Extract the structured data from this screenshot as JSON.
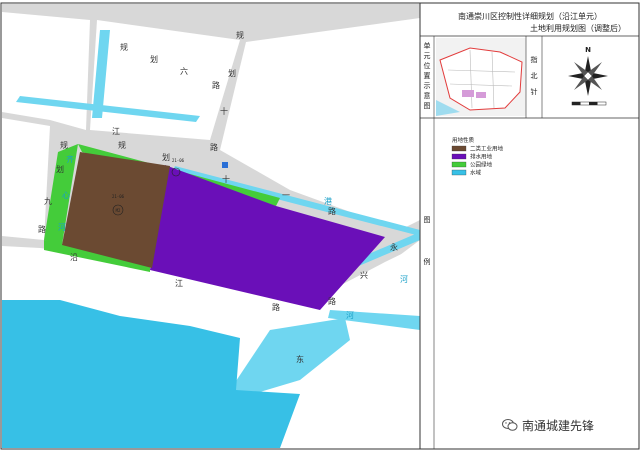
{
  "title": {
    "line1": "南通崇川区控制性详细规划（沿江单元）",
    "line2": "土地利用规划图（调整后）"
  },
  "side_panel": {
    "unit_location_label": [
      "单",
      "元",
      "位",
      "置",
      "示",
      "意",
      "图"
    ],
    "north_label": [
      "指",
      "北",
      "针"
    ],
    "north_letter": "N",
    "legend_label": [
      "图",
      "例"
    ]
  },
  "legend": {
    "title": "用地性质",
    "items": [
      {
        "label": "二类工业用地",
        "color": "#6b4a32"
      },
      {
        "label": "排水用地",
        "color": "#6a0fb8"
      },
      {
        "label": "公园绿地",
        "color": "#44cc3a"
      },
      {
        "label": "水域",
        "color": "#37c0e6"
      }
    ]
  },
  "map": {
    "roads": [
      {
        "id": "road-gui-hua-liu",
        "chars": [
          "规",
          "划",
          "六",
          "路"
        ]
      },
      {
        "id": "road-gui-hua-shi",
        "chars": [
          "规",
          "划",
          "十",
          "路"
        ]
      },
      {
        "id": "road-jiang-gui-hua",
        "chars": [
          "江",
          "规",
          "划"
        ]
      },
      {
        "id": "road-shi-yi-lu",
        "chars": [
          "十",
          "一",
          "路"
        ]
      },
      {
        "id": "road-yong-xing",
        "chars": [
          "永",
          "兴",
          "路"
        ]
      },
      {
        "id": "road-yan-jiang",
        "chars": [
          "沿",
          "江",
          "路"
        ]
      },
      {
        "id": "road-gui-hua-jiu",
        "chars": [
          "规",
          "划",
          "九",
          "路"
        ]
      },
      {
        "id": "road-dong",
        "chars": [
          "东"
        ]
      }
    ],
    "waterways": [
      {
        "id": "water-qi-xin-he",
        "chars": [
          "齐",
          "心",
          "河"
        ]
      },
      {
        "id": "water-gan-he",
        "chars": [
          "港",
          "河"
        ]
      },
      {
        "id": "water-he",
        "chars": [
          "河"
        ]
      }
    ],
    "parcel_codes": {
      "industrial": "21-06",
      "industrial_sub": "M2",
      "green": "21-06"
    }
  },
  "watermark": "南通城建先锋"
}
